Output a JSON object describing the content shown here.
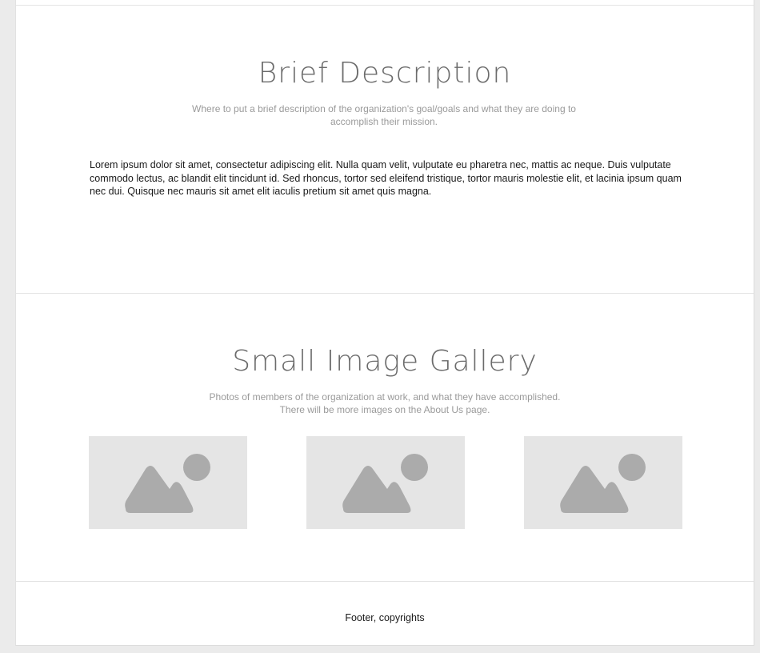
{
  "description": {
    "title": "Brief Description",
    "subtitle": "Where to put a brief description of the organization's goal/goals and what they are doing to accomplish their mission.",
    "body": "Lorem ipsum dolor sit amet, consectetur adipiscing elit. Nulla quam velit, vulputate eu pharetra nec, mattis ac neque. Duis vulputate commodo lectus, ac blandit elit tincidunt id. Sed rhoncus, tortor sed eleifend tristique, tortor mauris molestie elit, et lacinia ipsum quam nec dui. Quisque nec mauris sit amet elit iaculis pretium sit amet quis magna."
  },
  "gallery": {
    "title": "Small Image Gallery",
    "subtitle_line1": "Photos of members of the organization at work, and what they have accomplished.",
    "subtitle_line2": "There will be more images on the About Us page.",
    "images": [
      {
        "icon": "image-placeholder-icon"
      },
      {
        "icon": "image-placeholder-icon"
      },
      {
        "icon": "image-placeholder-icon"
      }
    ],
    "placeholder_bg": "#e5e5e5",
    "placeholder_fg": "#ababab"
  },
  "footer": {
    "text": "Footer, copyrights"
  }
}
